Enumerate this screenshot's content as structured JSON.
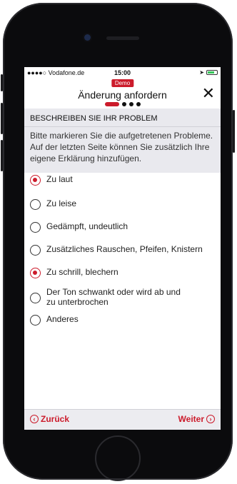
{
  "status": {
    "carrier": "●●●●○ Vodafone.de",
    "time": "15:00"
  },
  "header": {
    "badge": "Demo",
    "title": "Änderung anfordern",
    "close_icon": "✕"
  },
  "section": {
    "title": "BESCHREIBEN SIE IHR PROBLEM",
    "description": "Bitte markieren Sie die aufgetretenen Probleme. Auf der letzten Seite können Sie zusätzlich Ihre eigene Erklärung hinzufügen."
  },
  "options": [
    {
      "label": "Zu laut",
      "selected": true
    },
    {
      "label": "Zu leise",
      "selected": false
    },
    {
      "label": "Gedämpft, undeutlich",
      "selected": false
    },
    {
      "label": "Zusätzliches Rauschen, Pfeifen, Knistern",
      "selected": false
    },
    {
      "label": "Zu schrill, blechern",
      "selected": true
    },
    {
      "label": "Der Ton schwankt oder wird ab und zu unterbrochen",
      "selected": false
    },
    {
      "label": "Anderes",
      "selected": false
    }
  ],
  "footer": {
    "back_label": "Zurück",
    "next_label": "Weiter"
  },
  "colors": {
    "accent": "#cc1b2b"
  }
}
